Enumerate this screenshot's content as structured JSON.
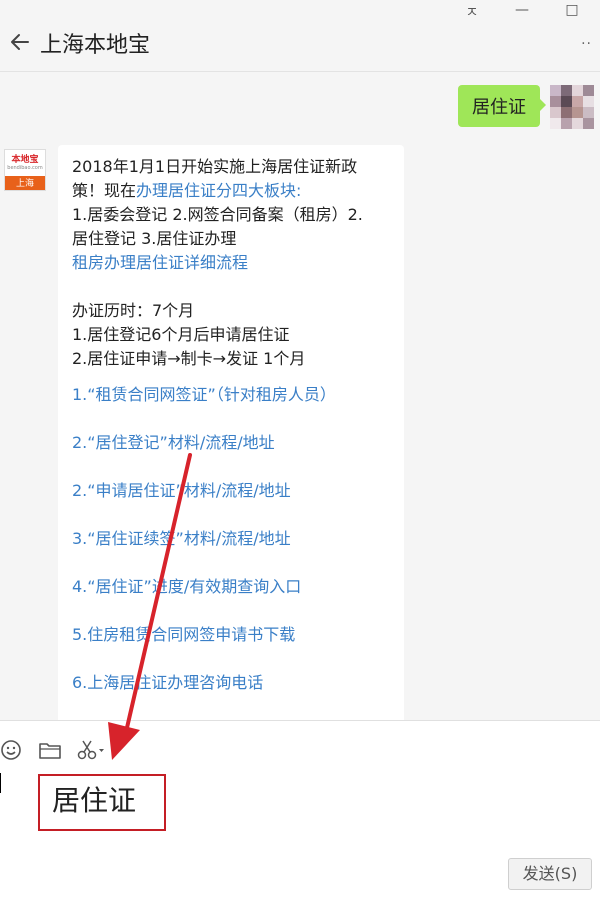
{
  "window": {
    "controls": [
      "ㅈ",
      "—",
      "□"
    ]
  },
  "header": {
    "title": "上海本地宝",
    "more": "··"
  },
  "messages": {
    "sent": {
      "text": "居住证"
    },
    "bot_avatar": {
      "brand": "本地宝",
      "site": "bendibao.com",
      "city": "上海"
    },
    "reply": {
      "line1": "2018年1月1日开始实施上海居住证新政",
      "line2_prefix": "策！现在",
      "line2_link": "办理居住证分四大板块:",
      "line3": "1.居委会登记 2.网签合同备案（租房）2.",
      "line4": "居住登记  3.居住证办理",
      "line5_link": "租房办理居住证详细流程",
      "line6": "办证历时：7个月",
      "line7": "1.居住登记6个月后申请居住证",
      "line8": "2.居住证申请→制卡→发证 1个月",
      "links": [
        "1.“租赁合同网签证”（针对租房人员）",
        "2.“居住登记”材料/流程/地址",
        "2.“申请居住证”材料/流程/地址",
        "3.“居住证续签”材料/流程/地址",
        "4.“居住证”进度/有效期查询入口",
        "5.住房租赁合同网签申请书下载",
        "6.上海居住证办理咨询电话"
      ]
    }
  },
  "input": {
    "typed": "居住证",
    "send_label": "发送(S)"
  },
  "colors": {
    "bubble_green": "#9fe658",
    "link_blue": "#3a7fc7",
    "annotation_red": "#c41e25"
  }
}
